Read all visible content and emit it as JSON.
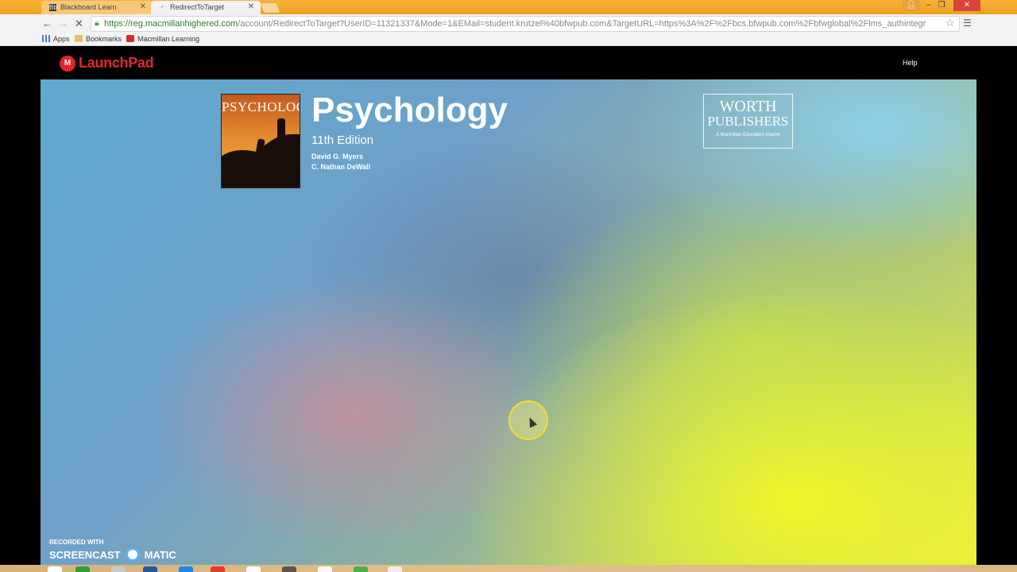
{
  "browser": {
    "tabs": [
      {
        "label": "Blackboard Learn",
        "active": false
      },
      {
        "label": "RedirectToTarget",
        "active": true
      }
    ],
    "url": {
      "host": "https://reg.macmillanhighered.com",
      "path": "/account/RedirectToTarget?UserID=11321337&Mode=1&EMail=student.krutzel%40bfwpub.com&TargetURL=https%3A%2F%2Fbcs.bfwpub.com%2Fbfwglobal%2Flms_authintegr"
    },
    "bookmarks": [
      "Apps",
      "Bookmarks",
      "Macmillan Learning"
    ]
  },
  "header": {
    "logo": "LaunchPad",
    "help": "Help"
  },
  "book": {
    "cover_title": "PSYCHOLOGY",
    "title": "Psychology",
    "edition": "11th Edition",
    "authors": [
      "David G. Myers",
      "C. Nathan DeWall"
    ]
  },
  "publisher": {
    "line1": "WORTH",
    "line2": "PUBLISHERS",
    "tagline": "A Macmillan Education Imprint"
  },
  "watermark": {
    "line1": "RECORDED WITH",
    "word1": "SCREENCAST",
    "word2": "MATIC"
  },
  "colors": {
    "accent": "#e5242b",
    "chrome_frame": "#f0a21c",
    "cursor_highlight": "#f4dd2a"
  }
}
